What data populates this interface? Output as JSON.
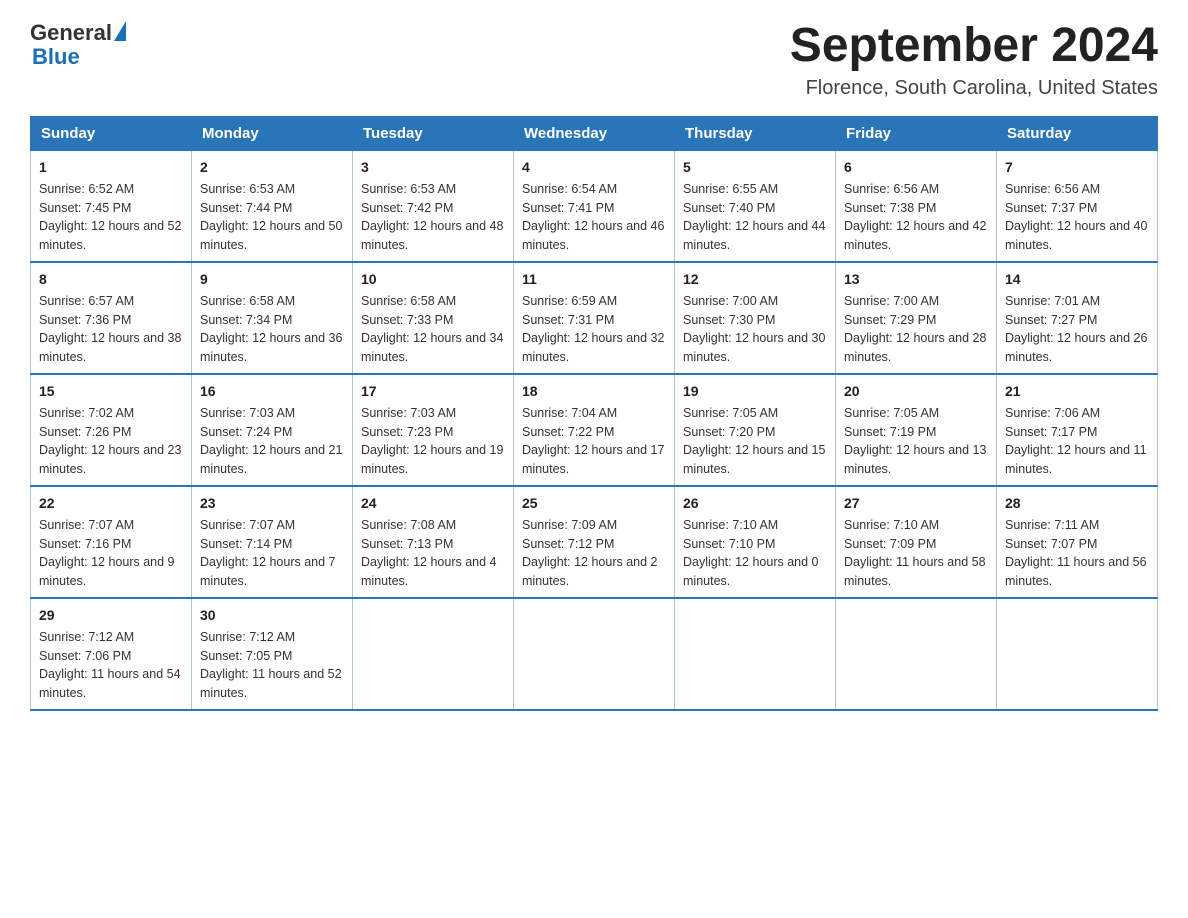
{
  "header": {
    "logo_general": "General",
    "logo_blue": "Blue",
    "month_year": "September 2024",
    "location": "Florence, South Carolina, United States"
  },
  "days_of_week": [
    "Sunday",
    "Monday",
    "Tuesday",
    "Wednesday",
    "Thursday",
    "Friday",
    "Saturday"
  ],
  "weeks": [
    [
      {
        "day": "1",
        "sunrise": "6:52 AM",
        "sunset": "7:45 PM",
        "daylight": "12 hours and 52 minutes."
      },
      {
        "day": "2",
        "sunrise": "6:53 AM",
        "sunset": "7:44 PM",
        "daylight": "12 hours and 50 minutes."
      },
      {
        "day": "3",
        "sunrise": "6:53 AM",
        "sunset": "7:42 PM",
        "daylight": "12 hours and 48 minutes."
      },
      {
        "day": "4",
        "sunrise": "6:54 AM",
        "sunset": "7:41 PM",
        "daylight": "12 hours and 46 minutes."
      },
      {
        "day": "5",
        "sunrise": "6:55 AM",
        "sunset": "7:40 PM",
        "daylight": "12 hours and 44 minutes."
      },
      {
        "day": "6",
        "sunrise": "6:56 AM",
        "sunset": "7:38 PM",
        "daylight": "12 hours and 42 minutes."
      },
      {
        "day": "7",
        "sunrise": "6:56 AM",
        "sunset": "7:37 PM",
        "daylight": "12 hours and 40 minutes."
      }
    ],
    [
      {
        "day": "8",
        "sunrise": "6:57 AM",
        "sunset": "7:36 PM",
        "daylight": "12 hours and 38 minutes."
      },
      {
        "day": "9",
        "sunrise": "6:58 AM",
        "sunset": "7:34 PM",
        "daylight": "12 hours and 36 minutes."
      },
      {
        "day": "10",
        "sunrise": "6:58 AM",
        "sunset": "7:33 PM",
        "daylight": "12 hours and 34 minutes."
      },
      {
        "day": "11",
        "sunrise": "6:59 AM",
        "sunset": "7:31 PM",
        "daylight": "12 hours and 32 minutes."
      },
      {
        "day": "12",
        "sunrise": "7:00 AM",
        "sunset": "7:30 PM",
        "daylight": "12 hours and 30 minutes."
      },
      {
        "day": "13",
        "sunrise": "7:00 AM",
        "sunset": "7:29 PM",
        "daylight": "12 hours and 28 minutes."
      },
      {
        "day": "14",
        "sunrise": "7:01 AM",
        "sunset": "7:27 PM",
        "daylight": "12 hours and 26 minutes."
      }
    ],
    [
      {
        "day": "15",
        "sunrise": "7:02 AM",
        "sunset": "7:26 PM",
        "daylight": "12 hours and 23 minutes."
      },
      {
        "day": "16",
        "sunrise": "7:03 AM",
        "sunset": "7:24 PM",
        "daylight": "12 hours and 21 minutes."
      },
      {
        "day": "17",
        "sunrise": "7:03 AM",
        "sunset": "7:23 PM",
        "daylight": "12 hours and 19 minutes."
      },
      {
        "day": "18",
        "sunrise": "7:04 AM",
        "sunset": "7:22 PM",
        "daylight": "12 hours and 17 minutes."
      },
      {
        "day": "19",
        "sunrise": "7:05 AM",
        "sunset": "7:20 PM",
        "daylight": "12 hours and 15 minutes."
      },
      {
        "day": "20",
        "sunrise": "7:05 AM",
        "sunset": "7:19 PM",
        "daylight": "12 hours and 13 minutes."
      },
      {
        "day": "21",
        "sunrise": "7:06 AM",
        "sunset": "7:17 PM",
        "daylight": "12 hours and 11 minutes."
      }
    ],
    [
      {
        "day": "22",
        "sunrise": "7:07 AM",
        "sunset": "7:16 PM",
        "daylight": "12 hours and 9 minutes."
      },
      {
        "day": "23",
        "sunrise": "7:07 AM",
        "sunset": "7:14 PM",
        "daylight": "12 hours and 7 minutes."
      },
      {
        "day": "24",
        "sunrise": "7:08 AM",
        "sunset": "7:13 PM",
        "daylight": "12 hours and 4 minutes."
      },
      {
        "day": "25",
        "sunrise": "7:09 AM",
        "sunset": "7:12 PM",
        "daylight": "12 hours and 2 minutes."
      },
      {
        "day": "26",
        "sunrise": "7:10 AM",
        "sunset": "7:10 PM",
        "daylight": "12 hours and 0 minutes."
      },
      {
        "day": "27",
        "sunrise": "7:10 AM",
        "sunset": "7:09 PM",
        "daylight": "11 hours and 58 minutes."
      },
      {
        "day": "28",
        "sunrise": "7:11 AM",
        "sunset": "7:07 PM",
        "daylight": "11 hours and 56 minutes."
      }
    ],
    [
      {
        "day": "29",
        "sunrise": "7:12 AM",
        "sunset": "7:06 PM",
        "daylight": "11 hours and 54 minutes."
      },
      {
        "day": "30",
        "sunrise": "7:12 AM",
        "sunset": "7:05 PM",
        "daylight": "11 hours and 52 minutes."
      },
      null,
      null,
      null,
      null,
      null
    ]
  ],
  "labels": {
    "sunrise_prefix": "Sunrise: ",
    "sunset_prefix": "Sunset: ",
    "daylight_prefix": "Daylight: "
  }
}
